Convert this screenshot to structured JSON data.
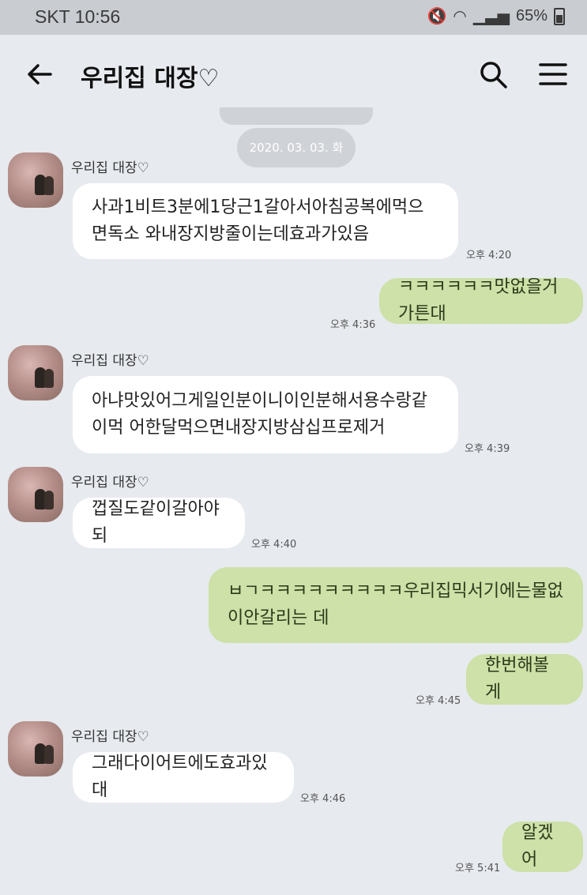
{
  "status": {
    "carrier_time": "SKT 10:56",
    "signal_text": "📶",
    "battery": "65%"
  },
  "header": {
    "title": "우리집 대장♡"
  },
  "date_divider": "2020. 03. 03. 화",
  "sender_name": "우리집 대장♡",
  "messages": [
    {
      "text": "사과1비트3분에1당근1갈아서아침공복에먹으면독소 와내장지방줄이는데효과가있음",
      "time": "오후 4:20"
    },
    {
      "text": "ㅋㅋㅋㅋㅋㅋ맛없을거가튼대",
      "time": "오후 4:36"
    },
    {
      "text": "아냐맛있어그게일인분이니이인분해서용수랑같이먹 어한달먹으면내장지방삼십프로제거",
      "time": "오후 4:39"
    },
    {
      "text": "껍질도같이갈아야되",
      "time": "오후 4:40"
    },
    {
      "text": "ㅂㄱㅋㅋㅋㅋㅋㅋㅋㅋㅋ우리집믹서기에는물없이안갈리는 데",
      "time": ""
    },
    {
      "text": "한번해볼게",
      "time": "오후 4:45"
    },
    {
      "text": "그래다이어트에도효과있대",
      "time": "오후 4:46"
    },
    {
      "text": "알겠어",
      "time": "오후 5:41"
    }
  ]
}
